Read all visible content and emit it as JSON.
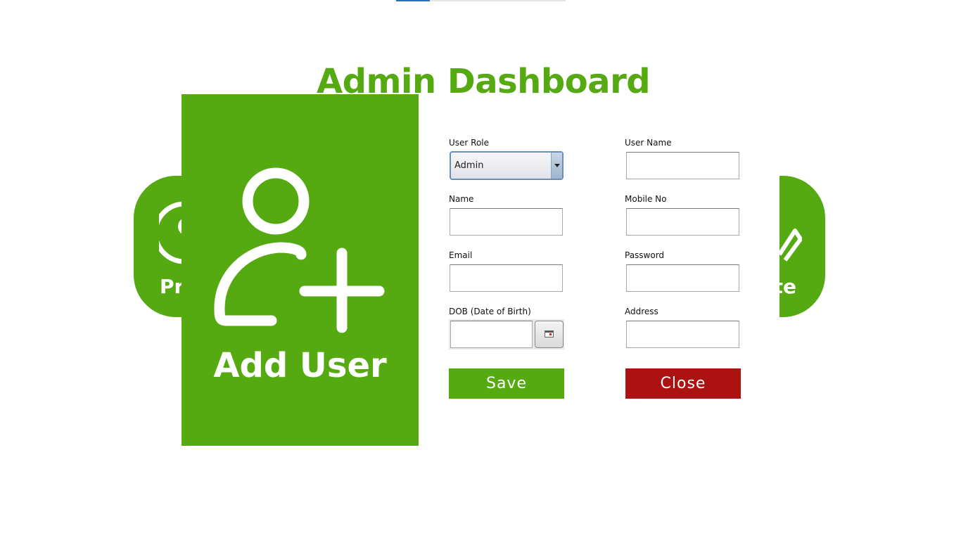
{
  "window": {
    "title": "Admin Dashboard"
  },
  "top_progress": {
    "fill_fraction": 0.2
  },
  "side_cards": {
    "left": {
      "label": "Pr",
      "icon": "profile-icon"
    },
    "right": {
      "label": "te",
      "icon": "pencil-icon"
    }
  },
  "add_user_card": {
    "label": "Add User",
    "icon": "add-user-icon"
  },
  "form": {
    "user_role": {
      "label": "User Role",
      "value": "Admin",
      "options": [
        "Admin"
      ]
    },
    "user_name": {
      "label": "User Name",
      "value": ""
    },
    "name": {
      "label": "Name",
      "value": ""
    },
    "mobile_no": {
      "label": "Mobile No",
      "value": ""
    },
    "email": {
      "label": "Email",
      "value": ""
    },
    "password": {
      "label": "Password",
      "value": ""
    },
    "dob": {
      "label": "DOB (Date of Birth)",
      "value": "",
      "button_icon": "calendar-icon"
    },
    "address": {
      "label": "Address",
      "value": ""
    }
  },
  "buttons": {
    "save": "Save",
    "close": "Close"
  },
  "colors": {
    "brand_green": "#55aa12",
    "close_red": "#ad1212"
  }
}
